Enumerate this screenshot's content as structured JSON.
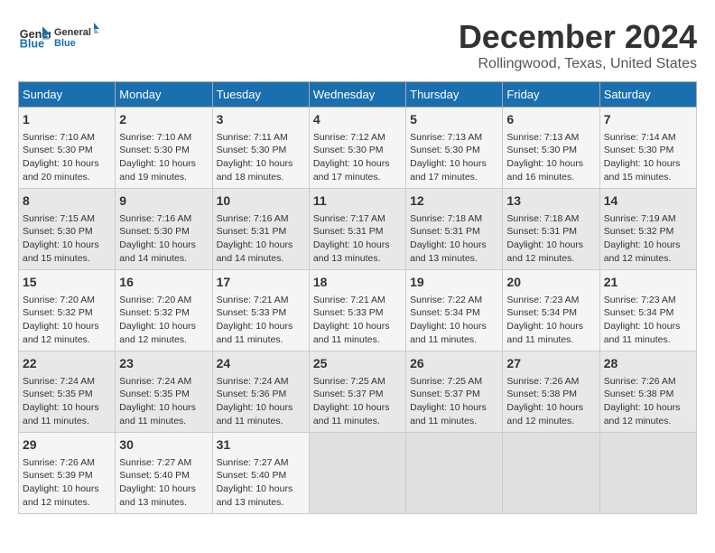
{
  "logo": {
    "line1": "General",
    "line2": "Blue"
  },
  "title": "December 2024",
  "location": "Rollingwood, Texas, United States",
  "days_of_week": [
    "Sunday",
    "Monday",
    "Tuesday",
    "Wednesday",
    "Thursday",
    "Friday",
    "Saturday"
  ],
  "weeks": [
    [
      {
        "day": "1",
        "info": "Sunrise: 7:10 AM\nSunset: 5:30 PM\nDaylight: 10 hours\nand 20 minutes."
      },
      {
        "day": "2",
        "info": "Sunrise: 7:10 AM\nSunset: 5:30 PM\nDaylight: 10 hours\nand 19 minutes."
      },
      {
        "day": "3",
        "info": "Sunrise: 7:11 AM\nSunset: 5:30 PM\nDaylight: 10 hours\nand 18 minutes."
      },
      {
        "day": "4",
        "info": "Sunrise: 7:12 AM\nSunset: 5:30 PM\nDaylight: 10 hours\nand 17 minutes."
      },
      {
        "day": "5",
        "info": "Sunrise: 7:13 AM\nSunset: 5:30 PM\nDaylight: 10 hours\nand 17 minutes."
      },
      {
        "day": "6",
        "info": "Sunrise: 7:13 AM\nSunset: 5:30 PM\nDaylight: 10 hours\nand 16 minutes."
      },
      {
        "day": "7",
        "info": "Sunrise: 7:14 AM\nSunset: 5:30 PM\nDaylight: 10 hours\nand 15 minutes."
      }
    ],
    [
      {
        "day": "8",
        "info": "Sunrise: 7:15 AM\nSunset: 5:30 PM\nDaylight: 10 hours\nand 15 minutes."
      },
      {
        "day": "9",
        "info": "Sunrise: 7:16 AM\nSunset: 5:30 PM\nDaylight: 10 hours\nand 14 minutes."
      },
      {
        "day": "10",
        "info": "Sunrise: 7:16 AM\nSunset: 5:31 PM\nDaylight: 10 hours\nand 14 minutes."
      },
      {
        "day": "11",
        "info": "Sunrise: 7:17 AM\nSunset: 5:31 PM\nDaylight: 10 hours\nand 13 minutes."
      },
      {
        "day": "12",
        "info": "Sunrise: 7:18 AM\nSunset: 5:31 PM\nDaylight: 10 hours\nand 13 minutes."
      },
      {
        "day": "13",
        "info": "Sunrise: 7:18 AM\nSunset: 5:31 PM\nDaylight: 10 hours\nand 12 minutes."
      },
      {
        "day": "14",
        "info": "Sunrise: 7:19 AM\nSunset: 5:32 PM\nDaylight: 10 hours\nand 12 minutes."
      }
    ],
    [
      {
        "day": "15",
        "info": "Sunrise: 7:20 AM\nSunset: 5:32 PM\nDaylight: 10 hours\nand 12 minutes."
      },
      {
        "day": "16",
        "info": "Sunrise: 7:20 AM\nSunset: 5:32 PM\nDaylight: 10 hours\nand 12 minutes."
      },
      {
        "day": "17",
        "info": "Sunrise: 7:21 AM\nSunset: 5:33 PM\nDaylight: 10 hours\nand 11 minutes."
      },
      {
        "day": "18",
        "info": "Sunrise: 7:21 AM\nSunset: 5:33 PM\nDaylight: 10 hours\nand 11 minutes."
      },
      {
        "day": "19",
        "info": "Sunrise: 7:22 AM\nSunset: 5:34 PM\nDaylight: 10 hours\nand 11 minutes."
      },
      {
        "day": "20",
        "info": "Sunrise: 7:23 AM\nSunset: 5:34 PM\nDaylight: 10 hours\nand 11 minutes."
      },
      {
        "day": "21",
        "info": "Sunrise: 7:23 AM\nSunset: 5:34 PM\nDaylight: 10 hours\nand 11 minutes."
      }
    ],
    [
      {
        "day": "22",
        "info": "Sunrise: 7:24 AM\nSunset: 5:35 PM\nDaylight: 10 hours\nand 11 minutes."
      },
      {
        "day": "23",
        "info": "Sunrise: 7:24 AM\nSunset: 5:35 PM\nDaylight: 10 hours\nand 11 minutes."
      },
      {
        "day": "24",
        "info": "Sunrise: 7:24 AM\nSunset: 5:36 PM\nDaylight: 10 hours\nand 11 minutes."
      },
      {
        "day": "25",
        "info": "Sunrise: 7:25 AM\nSunset: 5:37 PM\nDaylight: 10 hours\nand 11 minutes."
      },
      {
        "day": "26",
        "info": "Sunrise: 7:25 AM\nSunset: 5:37 PM\nDaylight: 10 hours\nand 11 minutes."
      },
      {
        "day": "27",
        "info": "Sunrise: 7:26 AM\nSunset: 5:38 PM\nDaylight: 10 hours\nand 12 minutes."
      },
      {
        "day": "28",
        "info": "Sunrise: 7:26 AM\nSunset: 5:38 PM\nDaylight: 10 hours\nand 12 minutes."
      }
    ],
    [
      {
        "day": "29",
        "info": "Sunrise: 7:26 AM\nSunset: 5:39 PM\nDaylight: 10 hours\nand 12 minutes."
      },
      {
        "day": "30",
        "info": "Sunrise: 7:27 AM\nSunset: 5:40 PM\nDaylight: 10 hours\nand 13 minutes."
      },
      {
        "day": "31",
        "info": "Sunrise: 7:27 AM\nSunset: 5:40 PM\nDaylight: 10 hours\nand 13 minutes."
      },
      {
        "day": "",
        "info": ""
      },
      {
        "day": "",
        "info": ""
      },
      {
        "day": "",
        "info": ""
      },
      {
        "day": "",
        "info": ""
      }
    ]
  ]
}
